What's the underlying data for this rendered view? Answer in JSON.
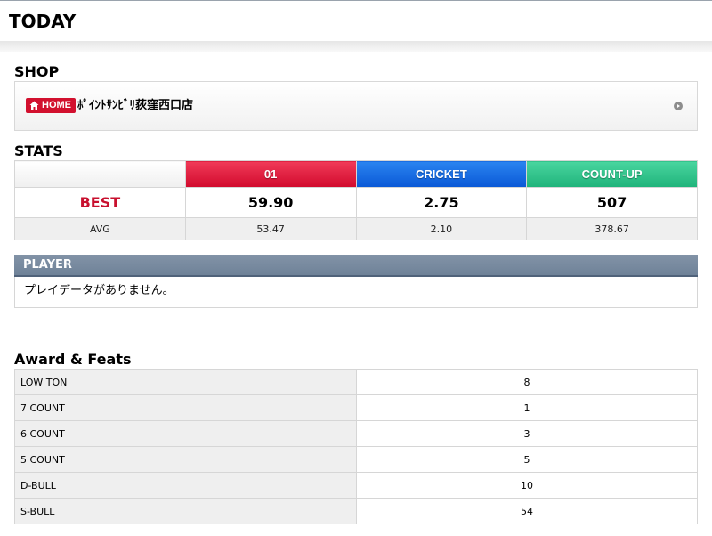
{
  "header": {
    "title": "TODAY"
  },
  "shop": {
    "section_title": "SHOP",
    "badge_label": "HOME",
    "badge_icon": "house-icon",
    "name": "ﾎﾟｲﾝﾄｻﾝﾋﾞﾘ荻窪西口店",
    "arrow_icon": "circle-arrow-right-icon"
  },
  "stats": {
    "section_title": "STATS",
    "columns": [
      "01",
      "CRICKET",
      "COUNT-UP"
    ],
    "column_colors": [
      "#d10a2d",
      "#0a58d6",
      "#1fb37a"
    ],
    "best": {
      "label": "BEST",
      "values": [
        "59.90",
        "2.75",
        "507"
      ]
    },
    "avg": {
      "label": "AVG",
      "values": [
        "53.47",
        "2.10",
        "378.67"
      ]
    }
  },
  "player": {
    "header": "PLAYER",
    "message": "プレイデータがありません。"
  },
  "awards": {
    "section_title": "Award & Feats",
    "rows": [
      {
        "name": "LOW TON",
        "value": "8"
      },
      {
        "name": "7 COUNT",
        "value": "1"
      },
      {
        "name": "6 COUNT",
        "value": "3"
      },
      {
        "name": "5 COUNT",
        "value": "5"
      },
      {
        "name": "D-BULL",
        "value": "10"
      },
      {
        "name": "S-BULL",
        "value": "54"
      }
    ]
  }
}
